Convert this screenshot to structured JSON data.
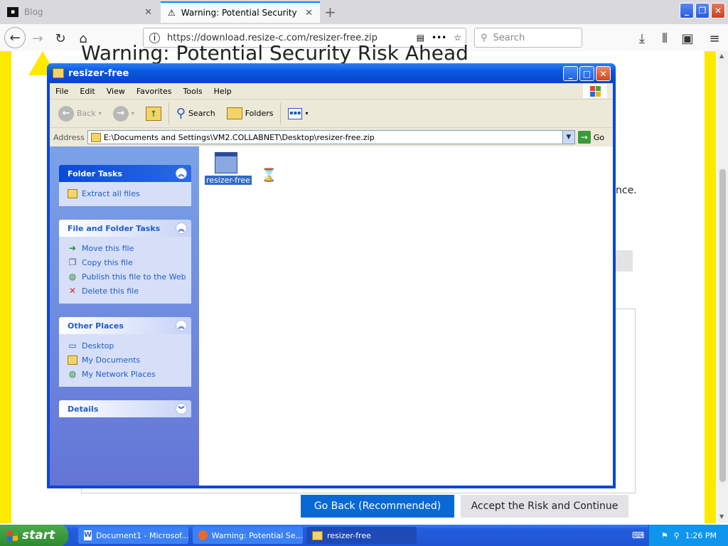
{
  "firefox": {
    "tabs": [
      {
        "label": "Blog",
        "active": false
      },
      {
        "label": "Warning: Potential Security Risk Ahead",
        "active": true
      }
    ],
    "new_tab_icon": "plus-icon",
    "url": "https://download.resize-c.com/resizer-free.zip",
    "search_placeholder": "Search"
  },
  "page": {
    "heading": "Warning: Potential Security Risk Ahead",
    "snippet": "nce.",
    "go_back_label": "Go Back (Recommended)",
    "accept_label": "Accept the Risk and Continue",
    "accent": "#ffe900",
    "primary_button_color": "#0a68d6"
  },
  "explorer": {
    "title": "resizer-free",
    "menu": [
      "File",
      "Edit",
      "View",
      "Favorites",
      "Tools",
      "Help"
    ],
    "toolbar": {
      "back": "Back",
      "search": "Search",
      "folders": "Folders"
    },
    "address_label": "Address",
    "address_value": "E:\\Documents and Settings\\VM2.COLLABNET\\Desktop\\resizer-free.zip",
    "go_label": "Go",
    "panels": {
      "folder_tasks": {
        "title": "Folder Tasks",
        "items": [
          "Extract all files"
        ]
      },
      "file_folder_tasks": {
        "title": "File and Folder Tasks",
        "items": [
          "Move this file",
          "Copy this file",
          "Publish this file to the Web",
          "Delete this file"
        ]
      },
      "other_places": {
        "title": "Other Places",
        "items": [
          "Desktop",
          "My Documents",
          "My Network Places"
        ]
      },
      "details": {
        "title": "Details"
      }
    },
    "file": {
      "name": "resizer-free"
    }
  },
  "taskbar": {
    "start_label": "start",
    "tasks": [
      "Document1 - Microsof...",
      "Warning: Potential Se...",
      "resizer-free"
    ],
    "clock": "1:26 PM"
  }
}
